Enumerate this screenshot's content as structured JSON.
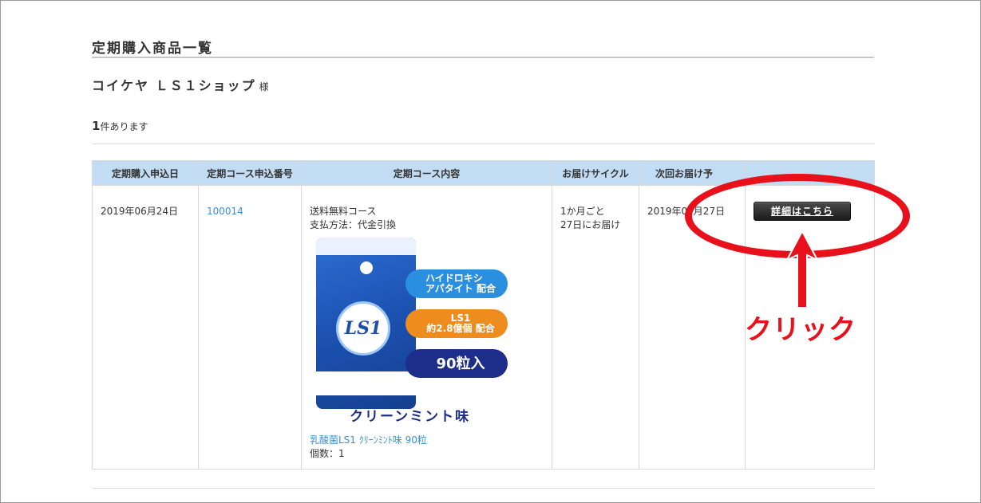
{
  "page": {
    "title": "定期購入商品一覧",
    "customer_name": "コイケヤ ＬＳ１ショップ",
    "customer_suffix": "様",
    "count_number": "1",
    "count_text": "件あります"
  },
  "table": {
    "headers": [
      "定期購入申込日",
      "定期コース申込番号",
      "定期コース内容",
      "お届けサイクル",
      "次回お届け予"
    ],
    "rows": [
      {
        "apply_date": "2019年06月24日",
        "course_number": "100014",
        "course_name": "送料無料コース",
        "payment": "支払方法：代金引換",
        "product_name": "乳酸菌LS1 ｸﾘｰﾝﾐﾝﾄ味 90粒",
        "quantity": "個数：1",
        "cycle_line1": "1か月ごと",
        "cycle_line2": "27日にお届け",
        "next_delivery": "2019年07月27日",
        "detail_label": "詳細はこちら"
      }
    ]
  },
  "product_image": {
    "logo": "LS1",
    "pill1_line1": "ハイドロキシ",
    "pill1_line2": "アパタイト 配合",
    "pill2_line1": "LS1",
    "pill2_line2": "約2.8億個 配合",
    "pill3": "90粒入",
    "flavor": "クリーンミント味"
  },
  "annotation": {
    "label": "クリック",
    "color": "#e8101b"
  }
}
